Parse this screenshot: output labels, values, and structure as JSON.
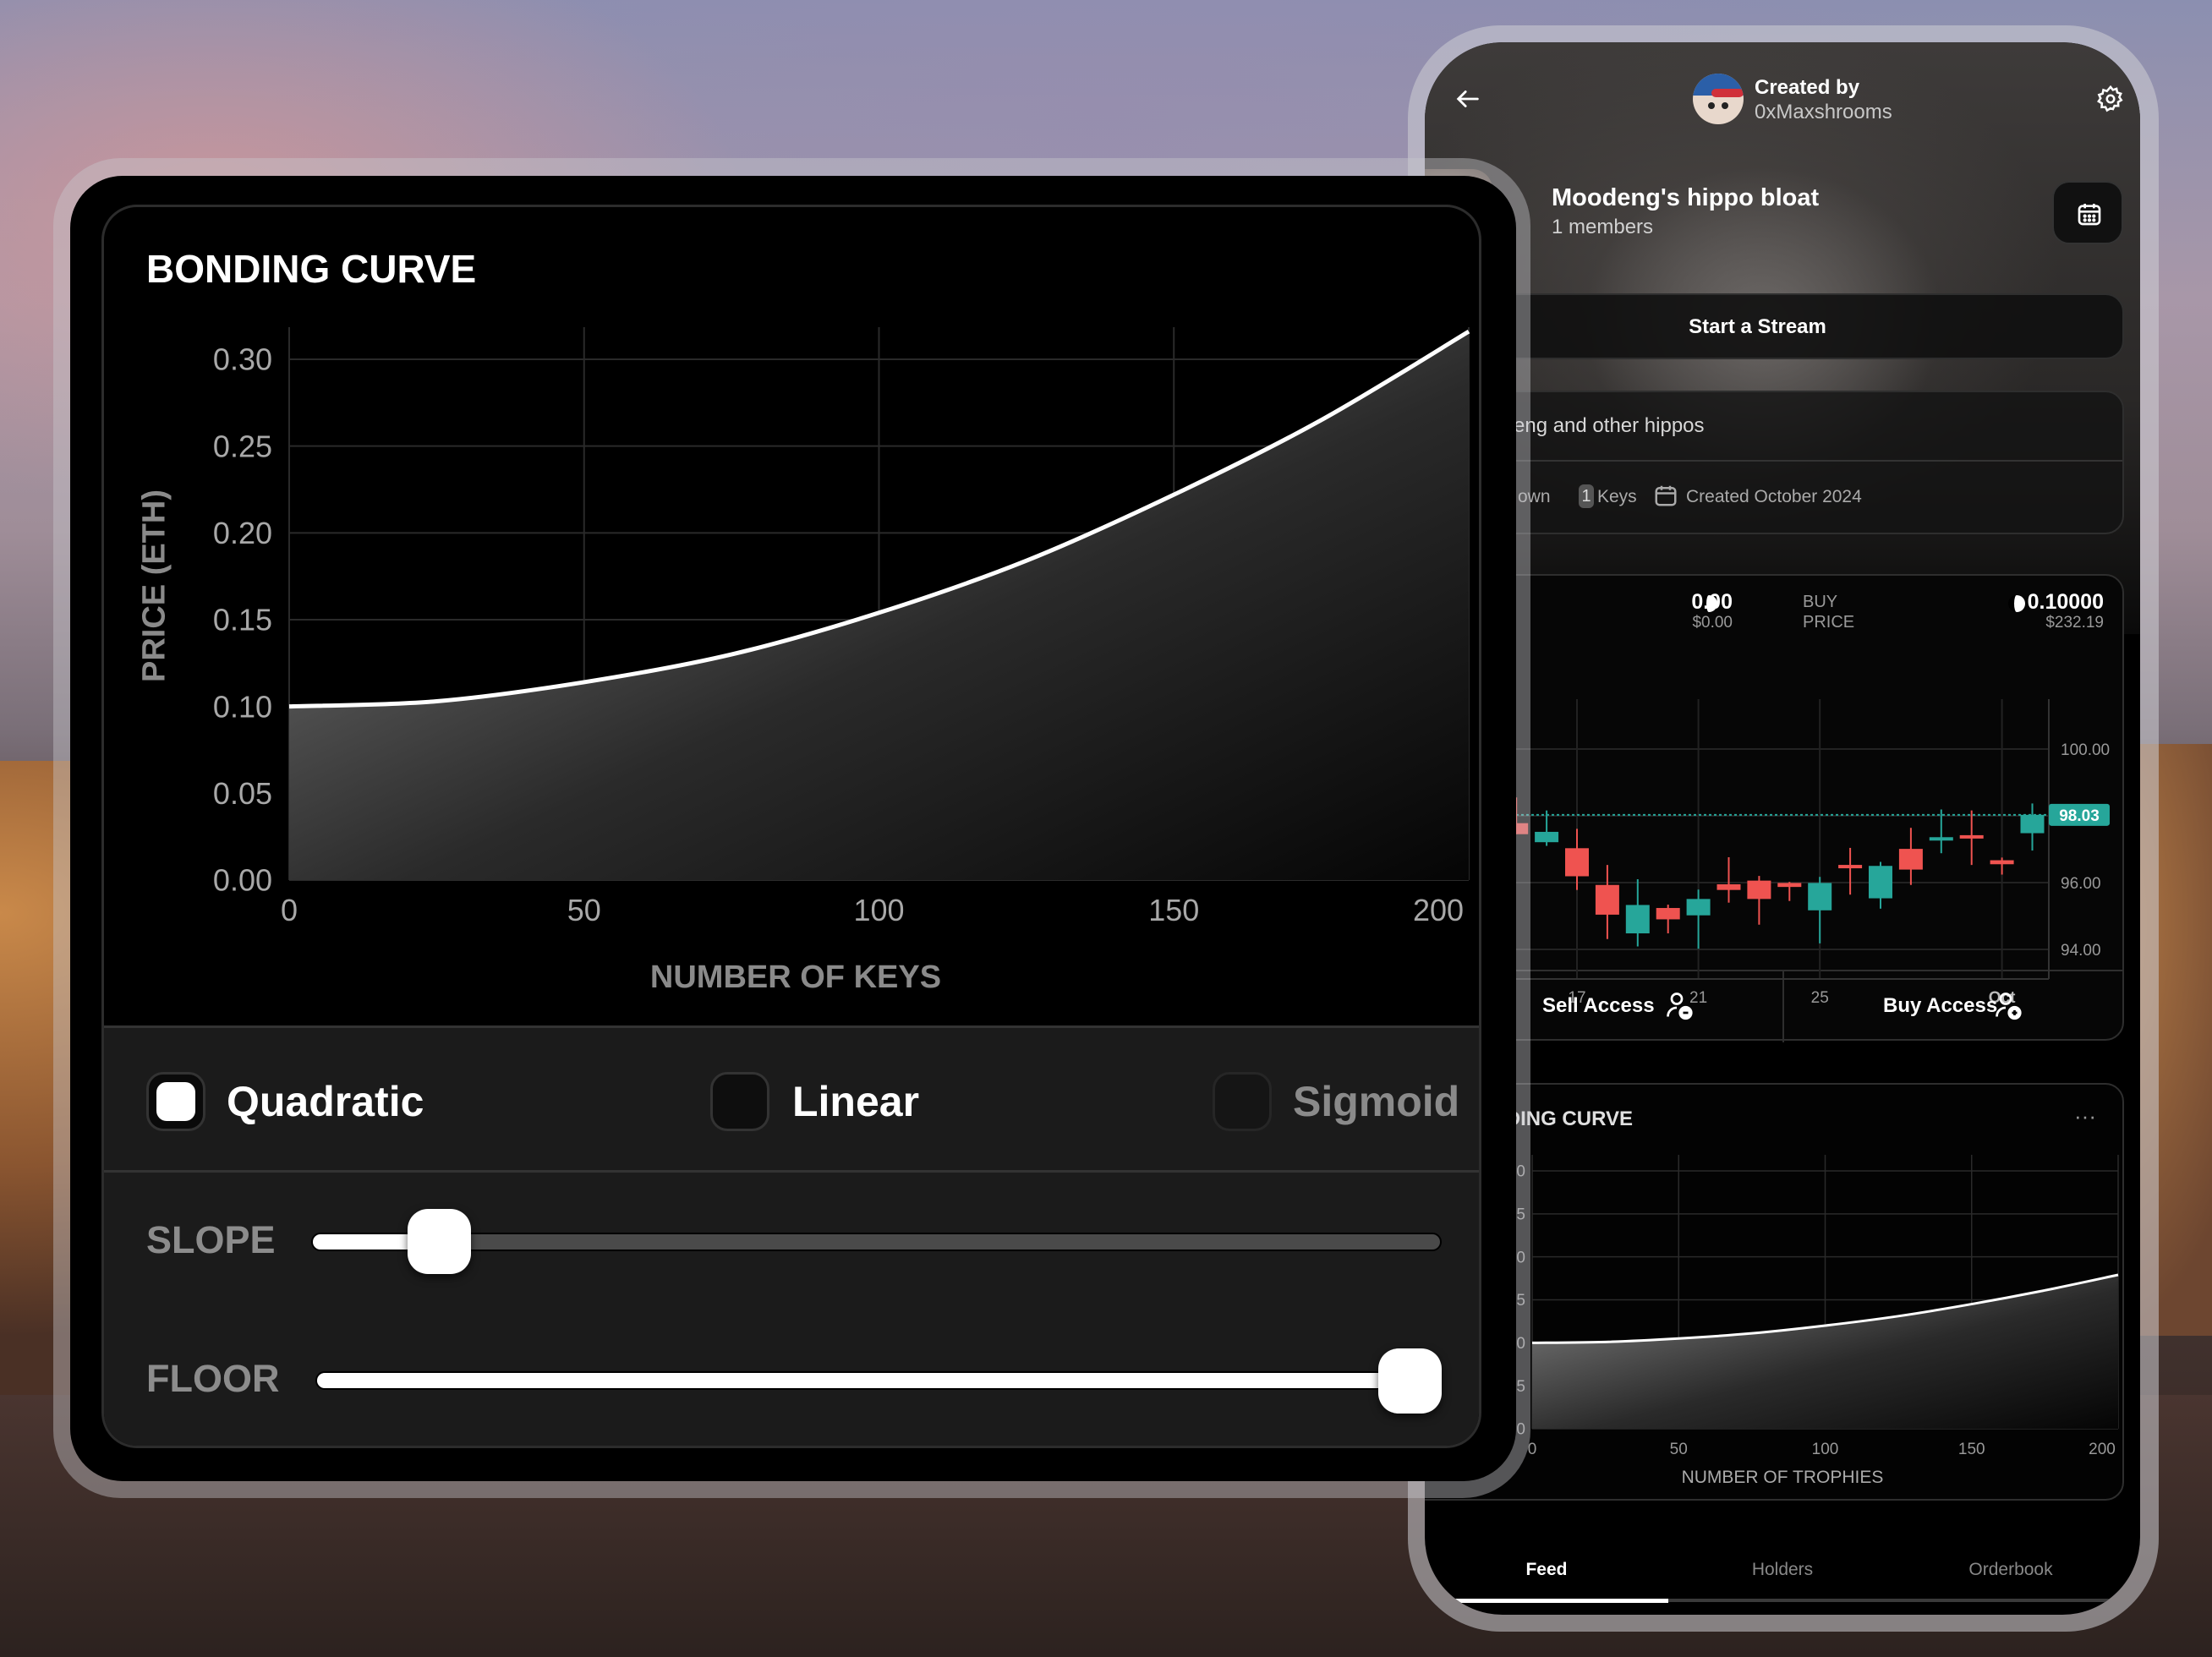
{
  "colors": {
    "up": "#26a69a",
    "down": "#ef5350",
    "accent": "#ffffff",
    "panel": "#1b1b1b"
  },
  "bonding_panel": {
    "title": "BONDING CURVE",
    "y_axis_label": "PRICE (ETH)",
    "x_axis_label": "NUMBER OF KEYS",
    "curve_options": [
      {
        "label": "Quadratic",
        "selected": true
      },
      {
        "label": "Linear",
        "selected": false
      },
      {
        "label": "Sigmoid",
        "selected": false
      }
    ],
    "sliders": [
      {
        "label": "SLOPE",
        "value": 0.09
      },
      {
        "label": "FLOOR",
        "value": 1.0
      }
    ]
  },
  "phone": {
    "header": {
      "back_icon": "arrow-left",
      "created_by_label": "Created by",
      "creator": "0xMaxshrooms",
      "settings_icon": "gear"
    },
    "group": {
      "name": "Moodeng's hippo bloat",
      "members": "1 members",
      "calendar_icon": "calendar"
    },
    "start_stream": "Start a Stream",
    "description": "eng and other hippos",
    "stats": {
      "own_label": "own",
      "keys_count": "1",
      "keys_label": "Keys",
      "created": "Created October 2024"
    },
    "trade": {
      "sell_price": "0.00",
      "sell_usd": "$0.00",
      "buy_label_1": "BUY",
      "buy_label_2": "PRICE",
      "buy_price": "0.10000",
      "buy_usd": "$232.19"
    },
    "sell_button": "Sell Access",
    "buy_button": "Buy Access",
    "curve_card_title": "BONDING CURVE",
    "curve_card_menu": "···",
    "tabs": [
      {
        "label": "Feed",
        "active": true
      },
      {
        "label": "Holders",
        "active": false
      },
      {
        "label": "Orderbook",
        "active": false
      }
    ]
  },
  "chart_data": [
    {
      "type": "area",
      "title": "BONDING CURVE",
      "xlabel": "NUMBER OF KEYS",
      "ylabel": "PRICE (ETH)",
      "x": [
        0,
        25,
        50,
        75,
        100,
        125,
        150,
        175,
        200
      ],
      "y": [
        0.1,
        0.103,
        0.114,
        0.13,
        0.154,
        0.184,
        0.222,
        0.265,
        0.316
      ],
      "xlim": [
        0,
        200
      ],
      "ylim": [
        0,
        0.318
      ],
      "x_ticks": [
        "0",
        "50",
        "100",
        "150",
        "200"
      ],
      "y_ticks": [
        "0.00",
        "0.05",
        "0.10",
        "0.15",
        "0.20",
        "0.25",
        "0.30"
      ],
      "grid": true
    },
    {
      "type": "candlestick",
      "x_ticks": [
        "17",
        "21",
        "25",
        "Oct"
      ],
      "y_ticks": [
        "100.00",
        "96.00",
        "94.00"
      ],
      "last_price": "98.03",
      "grid": true,
      "candles": [
        {
          "date": "Sep 15",
          "open": 97.78,
          "high": 98.55,
          "low": 97.45,
          "close": 97.45
        },
        {
          "date": "Sep 16",
          "open": 97.21,
          "high": 98.16,
          "low": 97.1,
          "close": 97.52
        },
        {
          "date": "Sep 17",
          "open": 97.03,
          "high": 97.61,
          "low": 95.78,
          "close": 96.19
        },
        {
          "date": "Sep 18",
          "open": 95.93,
          "high": 96.53,
          "low": 94.31,
          "close": 95.04
        },
        {
          "date": "Sep 19",
          "open": 94.48,
          "high": 96.1,
          "low": 94.09,
          "close": 95.33
        },
        {
          "date": "Sep 20",
          "open": 95.24,
          "high": 95.34,
          "low": 94.48,
          "close": 94.9
        },
        {
          "date": "Sep 21",
          "open": 95.02,
          "high": 95.79,
          "low": 94.02,
          "close": 95.51
        },
        {
          "date": "Sep 22",
          "open": 95.95,
          "high": 96.76,
          "low": 95.4,
          "close": 95.78
        },
        {
          "date": "Sep 23",
          "open": 96.06,
          "high": 96.2,
          "low": 94.74,
          "close": 95.51
        },
        {
          "date": "Sep 24",
          "open": 95.99,
          "high": 96.02,
          "low": 95.45,
          "close": 95.87
        },
        {
          "date": "Sep 25",
          "open": 95.17,
          "high": 96.17,
          "low": 94.18,
          "close": 95.99
        },
        {
          "date": "Sep 26",
          "open": 96.53,
          "high": 97.04,
          "low": 95.64,
          "close": 96.47
        },
        {
          "date": "Sep 27",
          "open": 95.53,
          "high": 96.62,
          "low": 95.22,
          "close": 96.5
        },
        {
          "date": "Sep 28",
          "open": 97.01,
          "high": 97.64,
          "low": 95.93,
          "close": 96.39
        },
        {
          "date": "Sep 29",
          "open": 97.3,
          "high": 98.19,
          "low": 96.88,
          "close": 97.36
        },
        {
          "date": "Sep 30",
          "open": 97.42,
          "high": 98.16,
          "low": 96.53,
          "close": 97.32
        },
        {
          "date": "Oct 1",
          "open": 96.67,
          "high": 96.75,
          "low": 96.24,
          "close": 96.55
        },
        {
          "date": "Oct 2",
          "open": 97.48,
          "high": 98.37,
          "low": 96.96,
          "close": 98.03
        }
      ]
    },
    {
      "type": "area",
      "title": "BONDING CURVE",
      "xlabel": "NUMBER OF TROPHIES",
      "x": [
        0,
        25,
        50,
        75,
        100,
        125,
        150,
        175,
        200
      ],
      "y": [
        0.1,
        0.101,
        0.105,
        0.111,
        0.12,
        0.131,
        0.145,
        0.161,
        0.179
      ],
      "xlim": [
        0,
        200
      ],
      "ylim": [
        0,
        0.318
      ],
      "x_ticks": [
        "0",
        "50",
        "100",
        "150",
        "200"
      ],
      "y_ticks": [
        "0.00",
        "0.05",
        "0.10",
        "0.15",
        "0.20",
        "0.25",
        "0.30"
      ],
      "grid": true
    }
  ]
}
